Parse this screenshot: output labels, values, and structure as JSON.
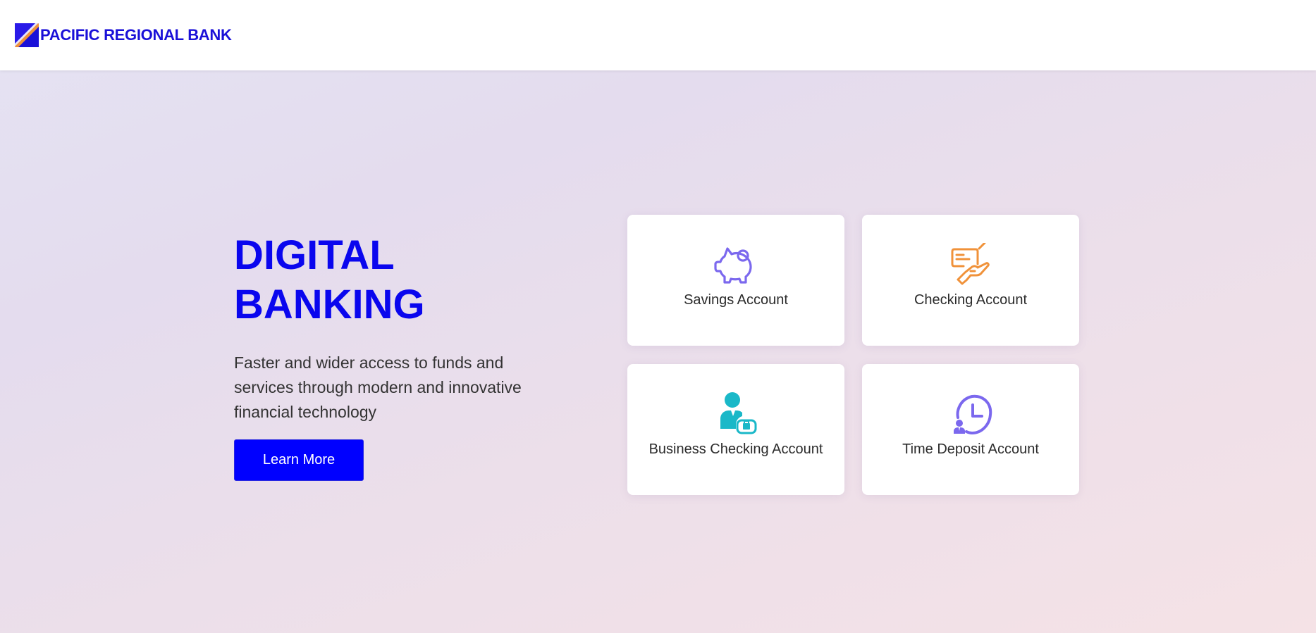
{
  "header": {
    "brand_name": "PACIFIC REGIONAL BANK",
    "logo_icon": "bank-logo-icon"
  },
  "hero": {
    "title_line1": "DIGITAL",
    "title_line2": "BANKING",
    "description": "Faster and wider access to funds and services through modern and innovative financial technology",
    "cta_label": "Learn More"
  },
  "cards": [
    {
      "label": "Savings Account",
      "icon": "piggy-bank-icon",
      "color": "#7b68ee"
    },
    {
      "label": "Checking Account",
      "icon": "check-payment-icon",
      "color": "#f0923a"
    },
    {
      "label": "Business Checking Account",
      "icon": "business-person-icon",
      "color": "#1ab8c8"
    },
    {
      "label": "Time Deposit Account",
      "icon": "clock-person-icon",
      "color": "#7b68ee"
    }
  ],
  "colors": {
    "brand_blue": "#0a06ee",
    "button_blue": "#0000ff",
    "logo_orange": "#f0923a"
  }
}
